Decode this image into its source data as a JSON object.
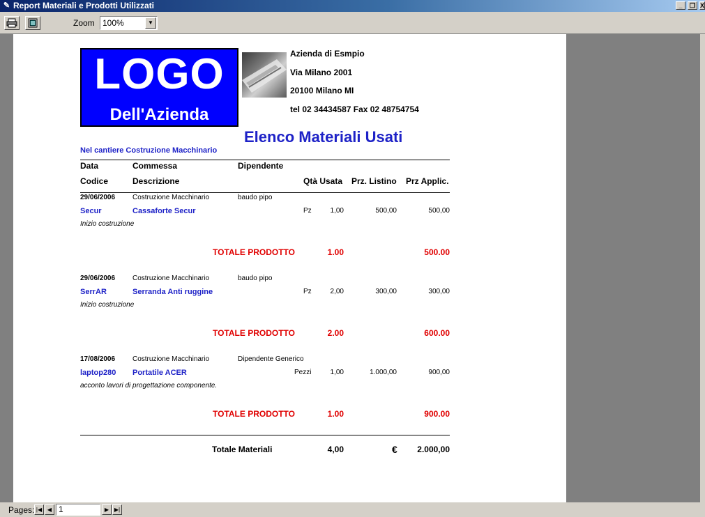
{
  "window": {
    "title": "Report Materiali e Prodotti Utilizzati",
    "icon": "report-icon",
    "min_label": "_",
    "restore_label": "❐",
    "close_label": "X"
  },
  "toolbar": {
    "print_icon": "printer-icon",
    "setup_icon": "page-setup-icon",
    "zoom_label": "Zoom",
    "zoom_value": "100%"
  },
  "report": {
    "logo_line1": "LOGO",
    "logo_line2": "Dell'Azienda",
    "company": {
      "name": "Azienda di Esmpio",
      "address": "Via Milano 2001",
      "city": "20100 Milano MI",
      "contacts": "tel 02 34434587  Fax 02 48754754"
    },
    "title": "Elenco Materiali Usati",
    "subtitle": "Nel cantiere Costruzione Macchinario",
    "headers": {
      "data": "Data",
      "commessa": "Commessa",
      "dipendente": "Dipendente",
      "codice": "Codice",
      "descrizione": "Descrizione",
      "qta": "Qtà Usata",
      "listino": "Prz. Listino",
      "applic": "Prz Applic."
    },
    "entries": [
      {
        "date": "29/06/2006",
        "commessa": "Costruzione Macchinario",
        "dipendente": "baudo pipo",
        "codice": "Secur",
        "descrizione": "Cassaforte Secur",
        "um": "Pz",
        "qta": "1,00",
        "listino": "500,00",
        "applic": "500,00",
        "note": "Inizio costruzione",
        "totale_label": "TOTALE PRODOTTO",
        "totale_qta": "1.00",
        "totale_importo": "500.00"
      },
      {
        "date": "29/06/2006",
        "commessa": "Costruzione Macchinario",
        "dipendente": "baudo pipo",
        "codice": "SerrAR",
        "descrizione": "Serranda Anti ruggine",
        "um": "Pz",
        "qta": "2,00",
        "listino": "300,00",
        "applic": "300,00",
        "note": "Inizio costruzione",
        "totale_label": "TOTALE PRODOTTO",
        "totale_qta": "2.00",
        "totale_importo": "600.00"
      },
      {
        "date": "17/08/2006",
        "commessa": "Costruzione Macchinario",
        "dipendente": "Dipendente Generico",
        "codice": "laptop280",
        "descrizione": "Portatile ACER",
        "um": "Pezzi",
        "qta": "1,00",
        "listino": "1.000,00",
        "applic": "900,00",
        "note": "acconto lavori di progettazione componente.",
        "totale_label": "TOTALE PRODOTTO",
        "totale_qta": "1.00",
        "totale_importo": "900.00"
      }
    ],
    "grand_total": {
      "label": "Totale Materiali",
      "qta": "4,00",
      "currency": "€",
      "amount": "2.000,00"
    }
  },
  "statusbar": {
    "pages_label": "Pages:",
    "page_value": "1",
    "first_label": "|◀",
    "prev_label": "◀",
    "next_label": "▶",
    "last_label": "▶|"
  }
}
